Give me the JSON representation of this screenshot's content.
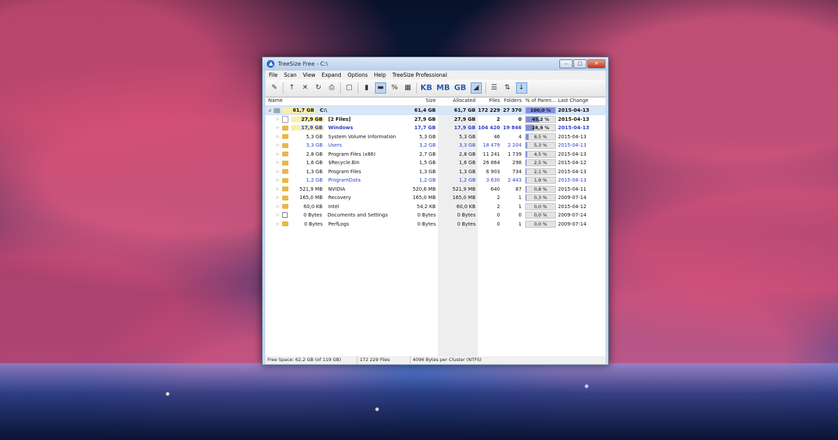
{
  "window": {
    "title": "TreeSize Free - C:\\"
  },
  "menu": [
    "File",
    "Scan",
    "View",
    "Expand",
    "Options",
    "Help",
    "TreeSize Professional"
  ],
  "toolbar": {
    "units": [
      "KB",
      "MB",
      "GB"
    ],
    "percent_symbol": "%"
  },
  "columns": {
    "name": "Name",
    "size": "Size",
    "allocated": "Allocated",
    "files": "Files",
    "folders": "Folders",
    "pct": "% of Paren...",
    "date": "Last Change"
  },
  "rows": [
    {
      "tree_size": "61,7 GB",
      "name": "C:\\",
      "size": "61,4 GB",
      "allocated": "61,7 GB",
      "files": "172 229",
      "folders": "27 370",
      "pct": "100,0 %",
      "pct_value": 100.0,
      "date": "2015-04-13",
      "style": "root",
      "icon": "drive-icon"
    },
    {
      "tree_size": "27,9 GB",
      "name": "[2 Files]",
      "size": "27,9 GB",
      "allocated": "27,9 GB",
      "files": "2",
      "folders": "0",
      "pct": "45,2 %",
      "pct_value": 45.2,
      "date": "2015-04-13",
      "style": "bold",
      "icon": "file-icon"
    },
    {
      "tree_size": "17,9 GB",
      "name": "Windows",
      "size": "17,7 GB",
      "allocated": "17,9 GB",
      "files": "104 420",
      "folders": "19 846",
      "pct": "28,9 %",
      "pct_value": 28.9,
      "date": "2015-04-13",
      "style": "bold-blue",
      "icon": "folder-icon"
    },
    {
      "tree_size": "5,3 GB",
      "name": "System Volume Information",
      "size": "5,3 GB",
      "allocated": "5,3 GB",
      "files": "46",
      "folders": "4",
      "pct": "8,5 %",
      "pct_value": 8.5,
      "date": "2015-04-13",
      "style": "normal",
      "icon": "folder-icon"
    },
    {
      "tree_size": "3,3 GB",
      "name": "Users",
      "size": "3,2 GB",
      "allocated": "3,3 GB",
      "files": "18 479",
      "folders": "2 204",
      "pct": "5,3 %",
      "pct_value": 5.3,
      "date": "2015-04-13",
      "style": "blue",
      "icon": "folder-icon"
    },
    {
      "tree_size": "2,8 GB",
      "name": "Program Files (x86)",
      "size": "2,7 GB",
      "allocated": "2,8 GB",
      "files": "11 241",
      "folders": "1 739",
      "pct": "4,5 %",
      "pct_value": 4.5,
      "date": "2015-04-13",
      "style": "normal",
      "icon": "folder-icon"
    },
    {
      "tree_size": "1,6 GB",
      "name": "$Recycle.Bin",
      "size": "1,5 GB",
      "allocated": "1,6 GB",
      "files": "26 864",
      "folders": "298",
      "pct": "2,5 %",
      "pct_value": 2.5,
      "date": "2015-04-12",
      "style": "normal",
      "icon": "folder-icon"
    },
    {
      "tree_size": "1,3 GB",
      "name": "Program Files",
      "size": "1,3 GB",
      "allocated": "1,3 GB",
      "files": "6 903",
      "folders": "734",
      "pct": "2,1 %",
      "pct_value": 2.1,
      "date": "2015-04-13",
      "style": "normal",
      "icon": "folder-icon"
    },
    {
      "tree_size": "1,2 GB",
      "name": "ProgramData",
      "size": "1,2 GB",
      "allocated": "1,2 GB",
      "files": "3 630",
      "folders": "2 443",
      "pct": "1,9 %",
      "pct_value": 1.9,
      "date": "2015-04-13",
      "style": "blue",
      "icon": "folder-icon"
    },
    {
      "tree_size": "521,9 MB",
      "name": "NVIDIA",
      "size": "520,6 MB",
      "allocated": "521,9 MB",
      "files": "640",
      "folders": "87",
      "pct": "0,8 %",
      "pct_value": 0.8,
      "date": "2015-04-11",
      "style": "normal",
      "icon": "folder-icon"
    },
    {
      "tree_size": "165,0 MB",
      "name": "Recovery",
      "size": "165,0 MB",
      "allocated": "165,0 MB",
      "files": "2",
      "folders": "1",
      "pct": "0,3 %",
      "pct_value": 0.3,
      "date": "2009-07-14",
      "style": "normal",
      "icon": "folder-icon"
    },
    {
      "tree_size": "60,0 KB",
      "name": "Intel",
      "size": "54,2 KB",
      "allocated": "60,0 KB",
      "files": "2",
      "folders": "1",
      "pct": "0,0 %",
      "pct_value": 0.0,
      "date": "2015-04-12",
      "style": "normal",
      "icon": "folder-icon"
    },
    {
      "tree_size": "0 Bytes",
      "name": "Documents and Settings",
      "size": "0 Bytes",
      "allocated": "0 Bytes",
      "files": "0",
      "folders": "0",
      "pct": "0,0 %",
      "pct_value": 0.0,
      "date": "2009-07-14",
      "style": "normal",
      "icon": "link-icon"
    },
    {
      "tree_size": "0 Bytes",
      "name": "PerfLogs",
      "size": "0 Bytes",
      "allocated": "0 Bytes",
      "files": "0",
      "folders": "1",
      "pct": "0,0 %",
      "pct_value": 0.0,
      "date": "2009-07-14",
      "style": "normal",
      "icon": "folder-icon"
    }
  ],
  "status": {
    "free_space": "Free Space: 62,2 GB  (of 119 GB)",
    "files": "172 229  Files",
    "cluster": "4096 Bytes per Cluster (NTFS)"
  }
}
